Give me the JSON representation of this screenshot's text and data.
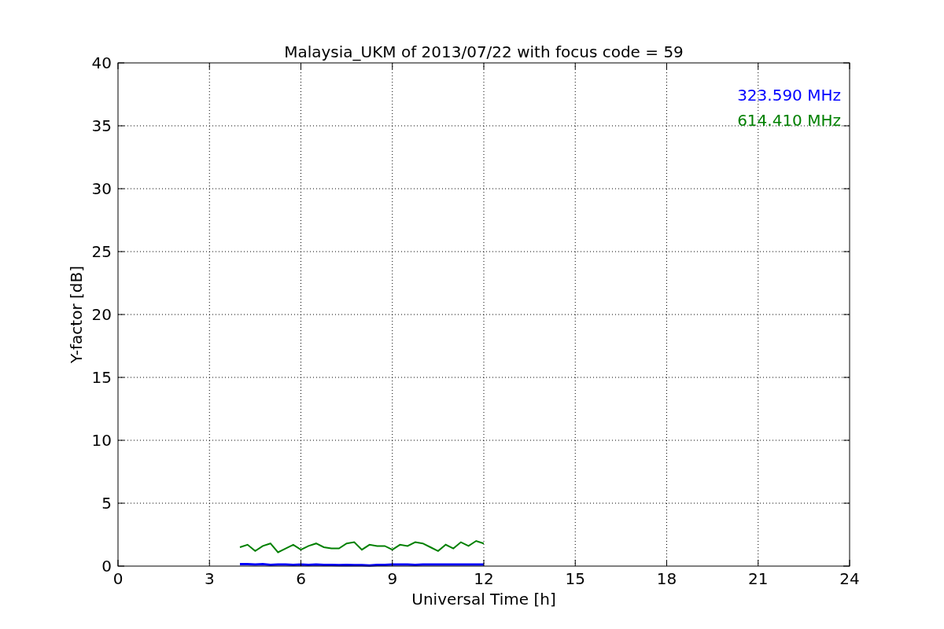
{
  "chart_data": {
    "type": "line",
    "title": "Malaysia_UKM of 2013/07/22 with focus code = 59",
    "xlabel": "Universal Time [h]",
    "ylabel": "Y-factor [dB]",
    "x": [
      4,
      4.25,
      4.5,
      4.75,
      5,
      5.25,
      5.5,
      5.75,
      6,
      6.25,
      6.5,
      6.75,
      7,
      7.25,
      7.5,
      7.75,
      8,
      8.25,
      8.5,
      8.75,
      9,
      9.25,
      9.5,
      9.75,
      10,
      10.25,
      10.5,
      10.75,
      11,
      11.25,
      11.5,
      11.75,
      12
    ],
    "series": [
      {
        "name": "323.590 MHz",
        "color": "#0000ff",
        "values": [
          0.15,
          0.15,
          0.12,
          0.15,
          0.1,
          0.12,
          0.12,
          0.1,
          0.12,
          0.1,
          0.12,
          0.1,
          0.1,
          0.08,
          0.1,
          0.08,
          0.08,
          0.05,
          0.1,
          0.1,
          0.12,
          0.12,
          0.12,
          0.1,
          0.12,
          0.12,
          0.12,
          0.12,
          0.12,
          0.12,
          0.12,
          0.12,
          0.12
        ]
      },
      {
        "name": "614.410 MHz",
        "color": "#008000",
        "values": [
          1.5,
          1.7,
          1.2,
          1.6,
          1.8,
          1.1,
          1.4,
          1.7,
          1.3,
          1.6,
          1.8,
          1.5,
          1.4,
          1.4,
          1.8,
          1.9,
          1.3,
          1.7,
          1.6,
          1.6,
          1.3,
          1.7,
          1.6,
          1.9,
          1.8,
          1.5,
          1.2,
          1.7,
          1.4,
          1.9,
          1.6,
          2.0,
          1.8
        ]
      }
    ],
    "grid": true,
    "xlim": [
      0,
      24
    ],
    "ylim": [
      0,
      40
    ],
    "xticks": [
      0,
      3,
      6,
      9,
      12,
      15,
      18,
      21,
      24
    ],
    "yticks": [
      0,
      5,
      10,
      15,
      20,
      25,
      30,
      35,
      40
    ]
  }
}
